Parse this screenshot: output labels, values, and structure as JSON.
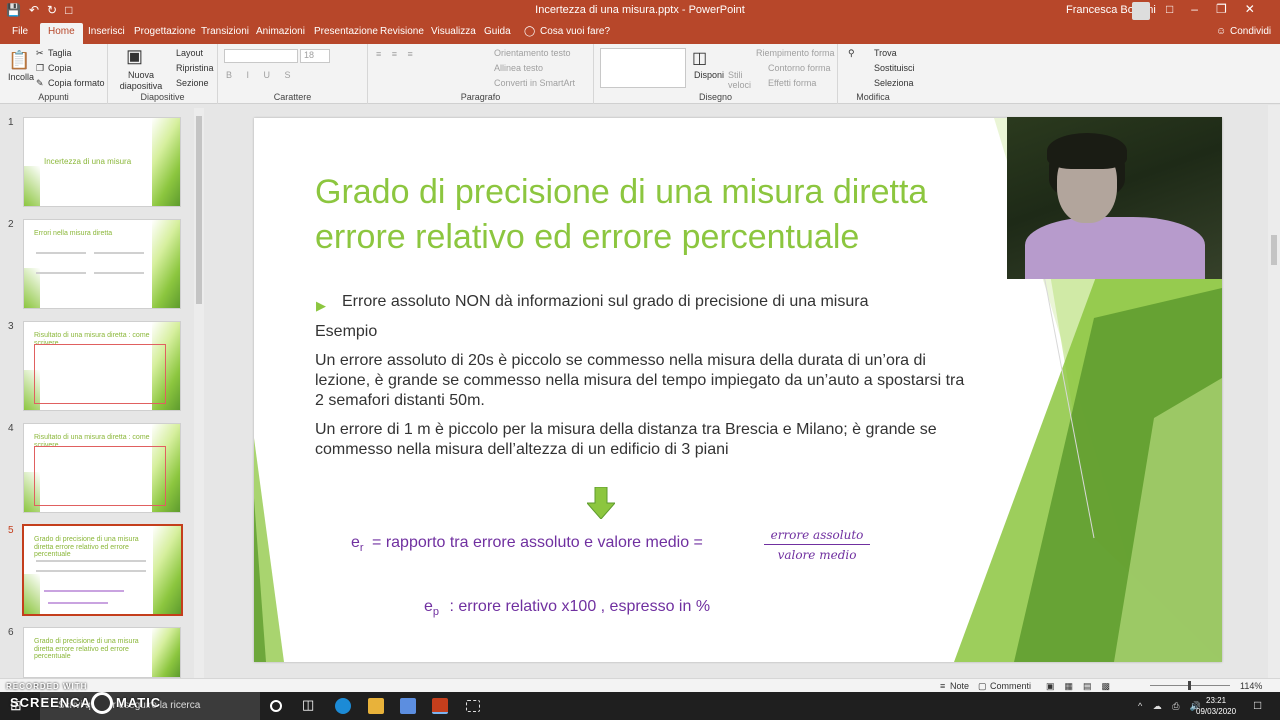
{
  "window": {
    "title": "Incertezza di una misura.pptx - PowerPoint",
    "user": "Francesca Bossini"
  },
  "tabs": [
    "File",
    "Home",
    "Inserisci",
    "Progettazione",
    "Transizioni",
    "Animazioni",
    "Presentazione",
    "Revisione",
    "Visualizza",
    "Guida",
    "Cosa vuoi fare?"
  ],
  "share_label": "Condividi",
  "ribbon": {
    "clipboard": {
      "paste": "Incolla",
      "cut": "Taglia",
      "copy": "Copia",
      "format": "Copia formato",
      "label": "Appunti"
    },
    "slides": {
      "new": "Nuova diapositiva",
      "layout": "Layout",
      "reset": "Ripristina",
      "section": "Sezione",
      "label": "Diapositive"
    },
    "font": {
      "size": "18",
      "label": "Carattere"
    },
    "paragraph": {
      "direction": "Orientamento testo",
      "align": "Allinea testo",
      "smartart": "Converti in SmartArt",
      "label": "Paragrafo"
    },
    "drawing": {
      "arrange": "Disponi",
      "styles": "Stili veloci",
      "fill": "Riempimento forma",
      "outline": "Contorno forma",
      "effects": "Effetti forma",
      "label": "Disegno"
    },
    "editing": {
      "find": "Trova",
      "replace": "Sostituisci",
      "select": "Seleziona",
      "label": "Modifica"
    }
  },
  "thumbnails": [
    {
      "num": "1",
      "title": "Incertezza di una misura"
    },
    {
      "num": "2",
      "title": "Errori nella misura diretta"
    },
    {
      "num": "3",
      "title": "Risultato di una misura diretta : come scrivere"
    },
    {
      "num": "4",
      "title": "Risultato di una misura diretta : come scrivere"
    },
    {
      "num": "5",
      "title": "Grado di precisione di una misura diretta errore relativo ed errore percentuale"
    },
    {
      "num": "6",
      "title": "Grado di precisione di una misura diretta errore relativo ed errore percentuale"
    }
  ],
  "slide": {
    "title": "Grado di precisione di una misura diretta errore relativo ed errore percentuale",
    "bullet": "Errore assoluto NON dà informazioni sul grado di precisione di una misura",
    "example_label": "Esempio",
    "p1": "Un errore assoluto di 20s è piccolo se commesso nella misura della durata di un’ora di lezione, è grande se commesso nella misura del tempo impiegato da un’auto a spostarsi tra 2 semafori distanti 50m.",
    "p2": "Un errore di 1 m è piccolo per la misura della distanza tra Brescia e Milano; è grande se  commesso nella misura dell’altezza di un edificio di 3 piani",
    "er_symbol": "e",
    "er_sub": "r",
    "er_text": "= rapporto tra errore assoluto e valore medio =",
    "frac_num": "errore assoluto",
    "frac_den": "valore medio",
    "ep_symbol": "e",
    "ep_sub": "p",
    "ep_text": ": errore relativo x100 , espresso in %"
  },
  "status": {
    "notes": "Note",
    "comments": "Commenti",
    "zoom": "114%"
  },
  "taskbar": {
    "search": "Scrivi qui per eseguire la ricerca",
    "time": "23:21",
    "date": "09/03/2020"
  },
  "watermark": {
    "recorded": "RECORDED WITH",
    "brand": "SCREENCAST",
    "brand2": "MATIC"
  },
  "colors": {
    "accent": "#b7472a",
    "title_green": "#8cc63f",
    "formula_purple": "#7030a0"
  }
}
